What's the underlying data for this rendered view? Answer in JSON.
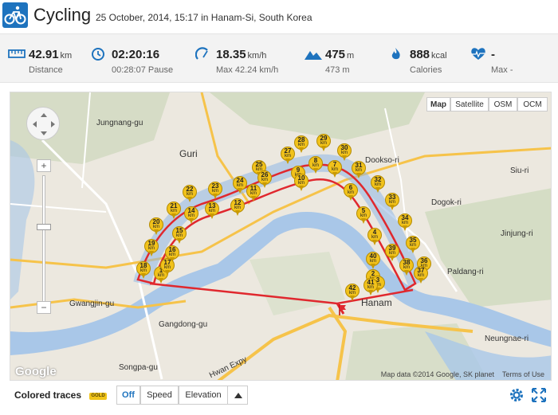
{
  "header": {
    "title": "Cycling",
    "subtitle": "25 October, 2014, 15:17 in Hanam-Si, South Korea",
    "sport_icon": "bicycle-icon",
    "accent_color": "#1e73be"
  },
  "stats": [
    {
      "name": "distance",
      "icon": "ruler-icon",
      "value": "42.91",
      "unit": "km",
      "sub": "Distance"
    },
    {
      "name": "duration",
      "icon": "clock-icon",
      "value": "02:20:16",
      "unit": "",
      "sub": "00:28:07 Pause"
    },
    {
      "name": "speed",
      "icon": "speedometer-icon",
      "value": "18.35",
      "unit": "km/h",
      "sub": "Max 42.24 km/h"
    },
    {
      "name": "elevation",
      "icon": "mountain-icon",
      "value": "475",
      "unit": "m",
      "sub": "473 m"
    },
    {
      "name": "calories",
      "icon": "flame-icon",
      "value": "888",
      "unit": "kcal",
      "sub": "Calories"
    },
    {
      "name": "heart-rate",
      "icon": "heart-rate-icon",
      "value": "-",
      "unit": "",
      "sub": "Max -"
    }
  ],
  "map": {
    "types": [
      "Map",
      "Satellite",
      "OSM",
      "OCM"
    ],
    "active_type": "Map",
    "zoom_in": "+",
    "zoom_out": "−",
    "google_logo": "Google",
    "credit": "Map data ©2014 Google, SK planet",
    "terms": "Terms of Use",
    "route_color": "#e0282e",
    "labels": [
      {
        "text": "Jungnang-gu"
      },
      {
        "text": "Guri"
      },
      {
        "text": "Gwangjin-gu"
      },
      {
        "text": "Gangdong-gu"
      },
      {
        "text": "Songpa-gu"
      },
      {
        "text": "Dookso-ri"
      },
      {
        "text": "Dogok-ri"
      },
      {
        "text": "Siu-ri"
      },
      {
        "text": "Jinjung-ri"
      },
      {
        "text": "Paldang-ri"
      },
      {
        "text": "Neungnae-ri"
      },
      {
        "text": "Hanam"
      },
      {
        "text": "Hwan Expy"
      }
    ],
    "markers": [
      "1",
      "2",
      "3",
      "4",
      "5",
      "6",
      "7",
      "8",
      "9",
      "10",
      "11",
      "12",
      "13",
      "14",
      "15",
      "16",
      "17",
      "18",
      "19",
      "20",
      "21",
      "22",
      "23",
      "24",
      "25",
      "26",
      "27",
      "28",
      "29",
      "30",
      "31",
      "32",
      "33",
      "34",
      "35",
      "36",
      "37",
      "38",
      "39",
      "40",
      "41",
      "42"
    ],
    "marker_unit": "km"
  },
  "controls": {
    "colored_traces_label": "Colored traces",
    "gold_badge": "GOLD",
    "options": [
      "Off",
      "Speed",
      "Elevation"
    ],
    "active_option": "Off",
    "collapse_icon": "triangle-up-icon",
    "settings_icon": "gear-icon",
    "fullscreen_icon": "fullscreen-icon"
  }
}
